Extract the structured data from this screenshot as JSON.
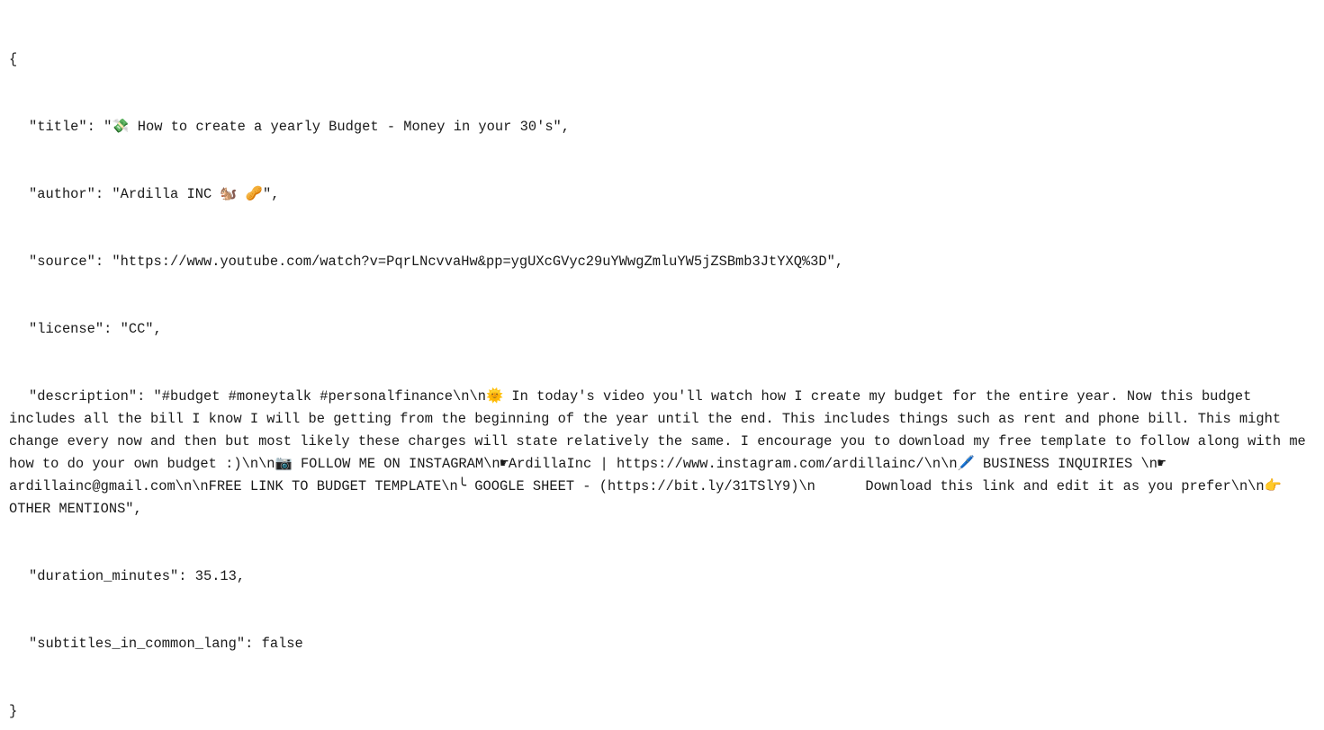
{
  "open_brace": "{",
  "close_brace": "}",
  "fields": [
    {
      "line": "\"title\": \"💸 How to create a yearly Budget - Money in your 30's\","
    },
    {
      "line": "\"author\": \"Ardilla INC 🐿️ 🥜\","
    },
    {
      "line": "\"source\": \"https://www.youtube.com/watch?v=PqrLNcvvaHw&pp=ygUXcGVyc29uYWwgZmluYW5jZSBmb3JtYXQ%3D\","
    },
    {
      "line": "\"license\": \"CC\","
    },
    {
      "line": "\"description\": \"#budget #moneytalk #personalfinance\\n\\n🌞 In today's video you'll watch how I create my budget for the entire year. Now this budget includes all the bill I know I will be getting from the beginning of the year until the end. This includes things such as rent and phone bill. This might change every now and then but most likely these charges will state relatively the same. I encourage you to download my free template to follow along with me how to do your own budget :)\\n\\n📷 FOLLOW ME ON INSTAGRAM\\n☛ArdillaInc | https://www.instagram.com/ardillainc/\\n\\n🖊️ BUSINESS INQUIRIES \\n☛ ardillainc@gmail.com\\n\\nFREE LINK TO BUDGET TEMPLATE\\n╰ GOOGLE SHEET - (https://bit.ly/31TSlY9)\\n      Download this link and edit it as you prefer\\n\\n👉 OTHER MENTIONS\","
    },
    {
      "line": "\"duration_minutes\": 35.13,"
    },
    {
      "line": "\"subtitles_in_common_lang\": false"
    }
  ]
}
